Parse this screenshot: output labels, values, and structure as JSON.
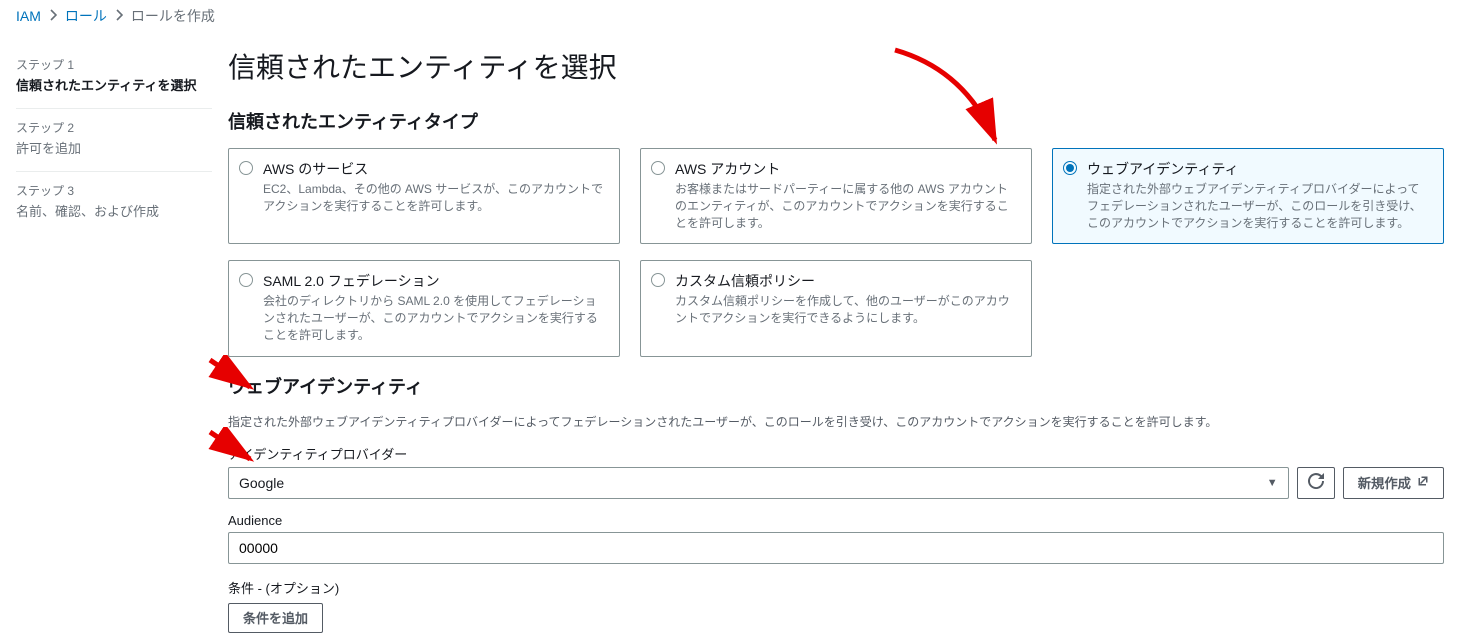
{
  "breadcrumb": {
    "items": [
      "IAM",
      "ロール"
    ],
    "current": "ロールを作成"
  },
  "sidebar": {
    "steps": [
      {
        "num": "ステップ 1",
        "title": "信頼されたエンティティを選択",
        "active": true
      },
      {
        "num": "ステップ 2",
        "title": "許可を追加",
        "active": false
      },
      {
        "num": "ステップ 3",
        "title": "名前、確認、および作成",
        "active": false
      }
    ]
  },
  "main": {
    "page_title": "信頼されたエンティティを選択",
    "entity_type_heading": "信頼されたエンティティタイプ",
    "entity_options": [
      {
        "title": "AWS のサービス",
        "desc": "EC2、Lambda、その他の AWS サービスが、このアカウントでアクションを実行することを許可します。",
        "selected": false
      },
      {
        "title": "AWS アカウント",
        "desc": "お客様またはサードパーティーに属する他の AWS アカウントのエンティティが、このアカウントでアクションを実行することを許可します。",
        "selected": false
      },
      {
        "title": "ウェブアイデンティティ",
        "desc": "指定された外部ウェブアイデンティティプロバイダーによってフェデレーションされたユーザーが、このロールを引き受け、このアカウントでアクションを実行することを許可します。",
        "selected": true
      },
      {
        "title": "SAML 2.0 フェデレーション",
        "desc": "会社のディレクトリから SAML 2.0 を使用してフェデレーションされたユーザーが、このアカウントでアクションを実行することを許可します。",
        "selected": false
      },
      {
        "title": "カスタム信頼ポリシー",
        "desc": "カスタム信頼ポリシーを作成して、他のユーザーがこのアカウントでアクションを実行できるようにします。",
        "selected": false
      }
    ],
    "web_identity": {
      "heading": "ウェブアイデンティティ",
      "desc": "指定された外部ウェブアイデンティティプロバイダーによってフェデレーションされたユーザーが、このロールを引き受け、このアカウントでアクションを実行することを許可します。",
      "provider_label": "アイデンティティプロバイダー",
      "provider_value": "Google",
      "audience_label": "Audience",
      "audience_value": "00000",
      "conditions_label": "条件 - (オプション)",
      "add_condition_label": "条件を追加",
      "create_new_label": "新規作成"
    }
  }
}
